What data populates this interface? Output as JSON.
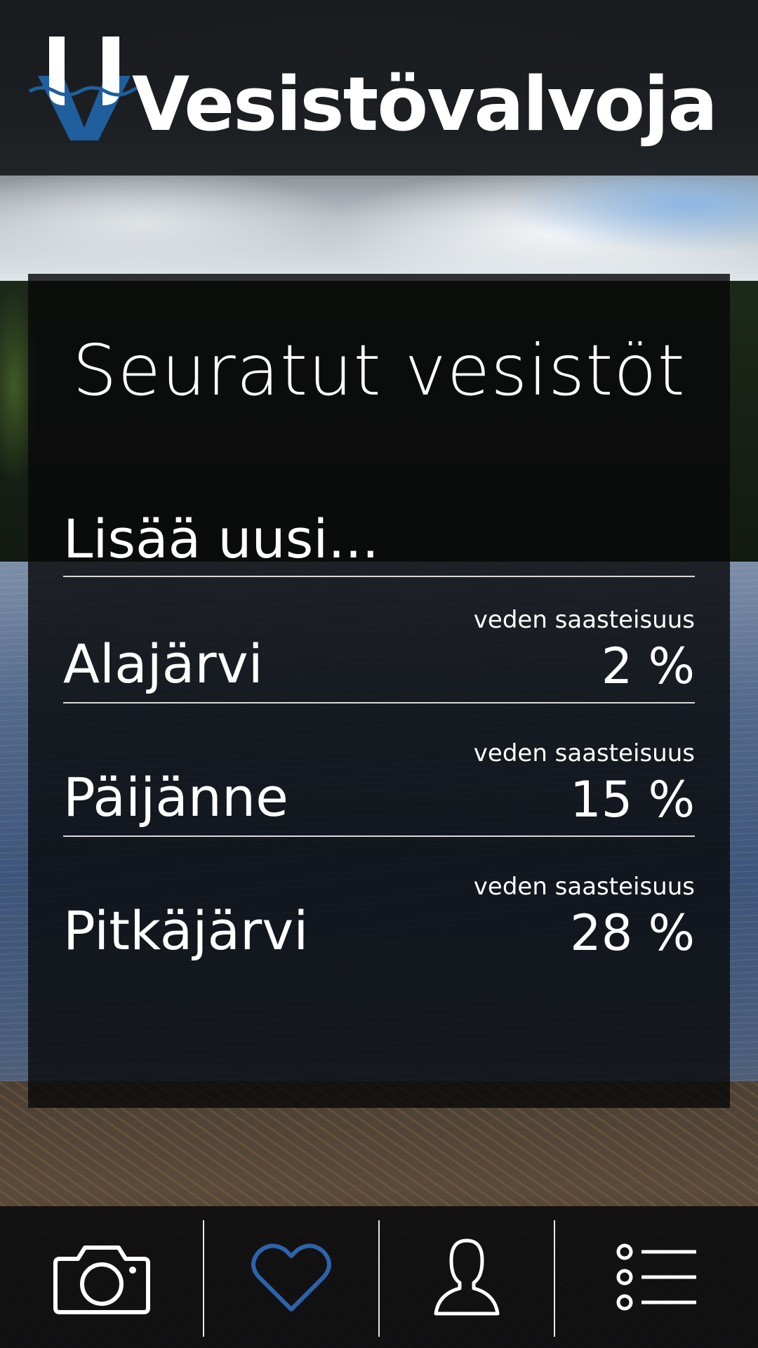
{
  "app": {
    "name": "Vesistövalvoja"
  },
  "panel": {
    "title": "Seuratut vesistöt",
    "add_new_label": "Lisää uusi..."
  },
  "lakes": [
    {
      "name": "Alajärvi",
      "metric_label": "veden saasteisuus",
      "value": "2 %"
    },
    {
      "name": "Päijänne",
      "metric_label": "veden saasteisuus",
      "value": "15 %"
    },
    {
      "name": "Pitkäjärvi",
      "metric_label": "veden saasteisuus",
      "value": "28 %"
    }
  ],
  "nav": {
    "items": [
      {
        "icon": "camera-icon",
        "active": false
      },
      {
        "icon": "heart-icon",
        "active": true
      },
      {
        "icon": "profile-icon",
        "active": false
      },
      {
        "icon": "menu-list-icon",
        "active": false
      }
    ]
  },
  "colors": {
    "brand_blue": "#1f5f9e",
    "active_icon": "#2c63ad",
    "text": "#ffffff",
    "divider": "#d9d9d9"
  }
}
